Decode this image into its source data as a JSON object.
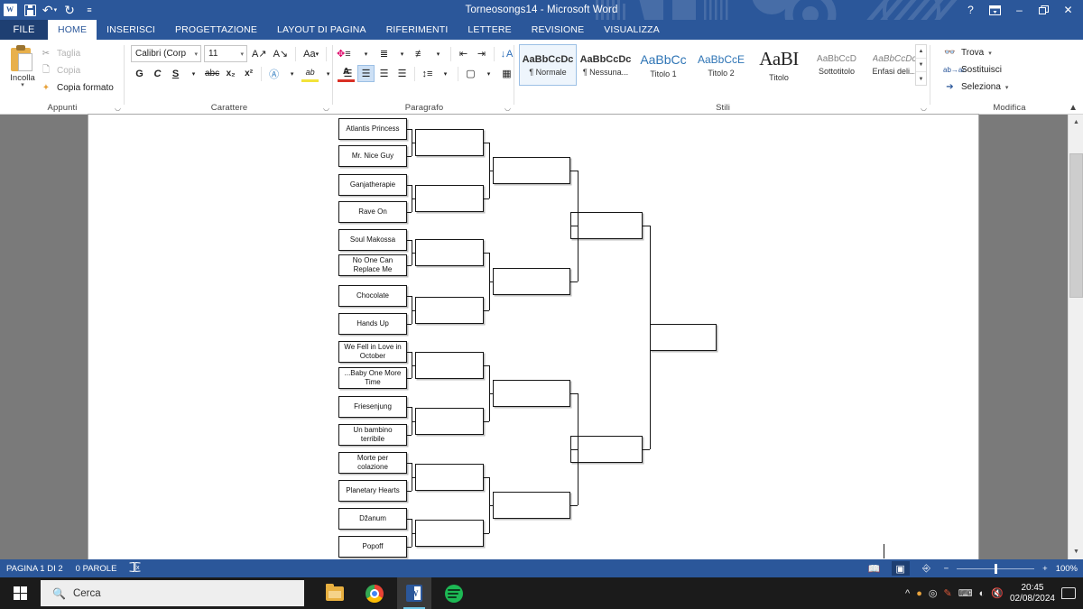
{
  "window": {
    "title": "Torneosongs14 - Microsoft Word",
    "quick_access": [
      "word-logo",
      "save-icon",
      "undo-icon",
      "redo-icon",
      "customize-qat-icon"
    ],
    "buttons": {
      "help": "?",
      "ribbon_display": "⌸",
      "minimize": "–",
      "restore": "❐",
      "close": "✕",
      "account": "account-avatar"
    }
  },
  "ribbon": {
    "file_tab": "FILE",
    "tabs": [
      {
        "label": "HOME",
        "active": true
      },
      {
        "label": "INSERISCI",
        "active": false
      },
      {
        "label": "PROGETTAZIONE",
        "active": false
      },
      {
        "label": "LAYOUT DI PAGINA",
        "active": false
      },
      {
        "label": "RIFERIMENTI",
        "active": false
      },
      {
        "label": "LETTERE",
        "active": false
      },
      {
        "label": "REVISIONE",
        "active": false
      },
      {
        "label": "VISUALIZZA",
        "active": false
      }
    ],
    "groups": {
      "clipboard": {
        "label": "Appunti",
        "paste": "Incolla",
        "items": [
          {
            "icon": "scissors-icon",
            "label": "Taglia",
            "enabled": false
          },
          {
            "icon": "copy-icon",
            "label": "Copia",
            "enabled": false
          },
          {
            "icon": "format-painter-icon",
            "label": "Copia formato",
            "enabled": true
          }
        ]
      },
      "font": {
        "label": "Carattere",
        "font_name": "Calibri (Corp",
        "font_size": "11",
        "buttons_row1": [
          "A↑",
          "A↓",
          "Aa"
        ],
        "clear_format": "clear-formatting-icon",
        "bold": "G",
        "italic": "C",
        "underline": "S",
        "strikethrough": "abc",
        "subscript": "x₂",
        "superscript": "x²",
        "text_effects": "A",
        "highlight": "highlight-icon",
        "font_color": "A"
      },
      "paragraph": {
        "label": "Paragrafo",
        "row1": [
          "bullets-icon",
          "numbering-icon",
          "multilevel-list-icon",
          "decrease-indent-icon",
          "increase-indent-icon",
          "sort-icon",
          "show-marks-icon"
        ],
        "row2": [
          "align-left-icon",
          "align-center-icon",
          "align-right-icon",
          "justify-icon",
          "line-spacing-icon",
          "shading-icon",
          "borders-icon"
        ],
        "active_alignment": "align-center-icon"
      },
      "styles": {
        "label": "Stili",
        "items": [
          {
            "preview": "AaBbCcDc",
            "name": "¶ Normale",
            "selected": true,
            "kind": "body"
          },
          {
            "preview": "AaBbCcDc",
            "name": "¶ Nessuna...",
            "selected": false,
            "kind": "body"
          },
          {
            "preview": "AaBbCс",
            "name": "Titolo 1",
            "selected": false,
            "kind": "h1"
          },
          {
            "preview": "AaBbCcE",
            "name": "Titolo 2",
            "selected": false,
            "kind": "h2"
          },
          {
            "preview": "AaBІ",
            "name": "Titolo",
            "selected": false,
            "kind": "tit"
          },
          {
            "preview": "AaBbCcD",
            "name": "Sottotitolo",
            "selected": false,
            "kind": "sub"
          },
          {
            "preview": "AaBbCcDс",
            "name": "Enfasi deli...",
            "selected": false,
            "kind": "emp"
          }
        ]
      },
      "editing": {
        "label": "Modifica",
        "items": [
          {
            "icon": "binoculars-icon",
            "label": "Trova",
            "has_dropdown": true
          },
          {
            "icon": "replace-icon",
            "label": "Sostituisci",
            "has_dropdown": false
          },
          {
            "icon": "select-cursor-icon",
            "label": "Seleziona",
            "has_dropdown": true
          }
        ]
      }
    }
  },
  "bracket": {
    "round1": [
      "Atlantis Princess",
      "Mr. Nice Guy",
      "Ganjatherapie",
      "Rave On",
      "Soul Makossa",
      "No One Can Replace Me",
      "Chocolate",
      "Hands Up",
      "We Fell in Love in October",
      "...Baby One More Time",
      "Friesenjung",
      "Un bambino terribile",
      "Morte per colazione",
      "Planetary Hearts",
      "Džanum",
      "Popoff"
    ],
    "round2": [
      "",
      "",
      "",
      "",
      "",
      "",
      "",
      ""
    ],
    "round3": [
      "",
      "",
      "",
      ""
    ],
    "round4": [
      "",
      ""
    ],
    "champion": [
      ""
    ]
  },
  "status_bar": {
    "page": "PAGINA 1 DI 2",
    "words": "0 PAROLE",
    "proofing_icon": "proofing-errors-icon",
    "views": [
      {
        "icon": "read-mode-icon",
        "active": false
      },
      {
        "icon": "print-layout-icon",
        "active": true
      },
      {
        "icon": "web-layout-icon",
        "active": false
      }
    ],
    "zoom_out": "−",
    "zoom_in": "+",
    "zoom_level": "100%"
  },
  "taskbar": {
    "start": "start-button",
    "search_placeholder": "Cerca",
    "apps": [
      {
        "icon": "file-explorer-icon",
        "active": false
      },
      {
        "icon": "chrome-icon",
        "active": false
      },
      {
        "icon": "word-icon",
        "active": true
      },
      {
        "icon": "spotify-icon",
        "active": false
      }
    ],
    "tray": [
      "show-hidden-icons-icon",
      "spotify-tray-icon",
      "camera-icon",
      "paint-icon",
      "keyboard-icon",
      "wifi-icon",
      "volume-muted-icon"
    ],
    "time": "20:45",
    "date": "02/08/2024",
    "action_center": "action-center-icon"
  }
}
